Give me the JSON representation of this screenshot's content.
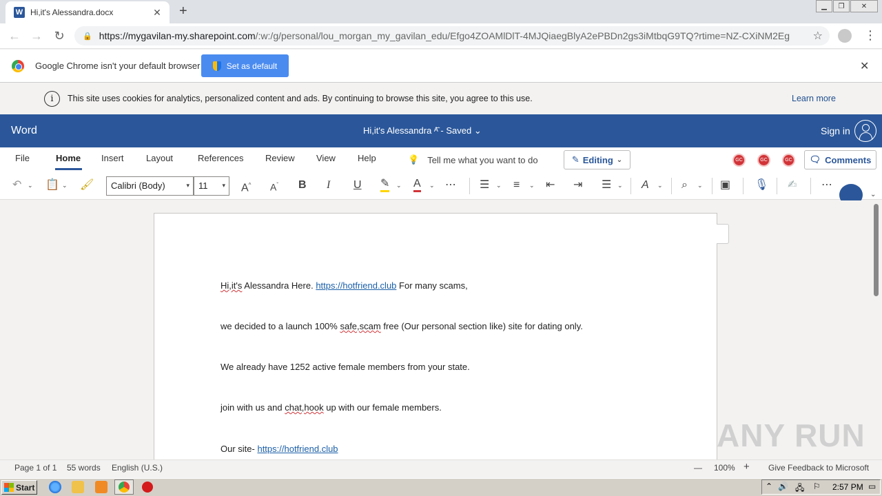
{
  "browser": {
    "tab_title": "Hi,it's Alessandra.docx",
    "tab_close": "✕",
    "new_tab": "+",
    "url_domain": "https://mygavilan-my.sharepoint.com",
    "url_path": "/:w:/g/personal/lou_morgan_my_gavilan_edu/Efgo4ZOAMlDlT-4MJQiaegBlyA2ePBDn2gs3iMtbqG9TQ?rtime=NZ-CXiNM2Eg",
    "infobar_text": "Google Chrome isn't your default browser",
    "set_default_label": "Set as default"
  },
  "cookie_banner": {
    "text": "This site uses cookies for analytics, personalized content and ads. By continuing to browse this site, you agree to this use.",
    "learn_more": "Learn more",
    "info_glyph": "i"
  },
  "word": {
    "brand": "Word",
    "doc_title": "Hi,it's Alessandra  ᴬ᷈ -  Saved ⌄",
    "sign_in": "Sign in",
    "tabs": [
      "File",
      "Home",
      "Insert",
      "Layout",
      "References",
      "Review",
      "View",
      "Help"
    ],
    "tell_me": "Tell me what you want to do",
    "editing_label": "Editing",
    "coauthors": [
      "GC",
      "GC",
      "GC"
    ],
    "comments_label": "Comments",
    "font_name": "Calibri (Body)",
    "font_size": "11"
  },
  "document": {
    "line1_pre": "Hi,it's",
    "line1_mid": " Alessandra Here. ",
    "line1_link": "https://hotfriend.club",
    "line1_post": " For many scams,",
    "line2_pre": "we decided to a launch 100% ",
    "line2_squig": "safe,scam",
    "line2_post": " free (Our personal section like) site for dating only.",
    "line3": "We already have 1252 active female members from your state.",
    "line4_pre": "join with us and ",
    "line4_squig": "chat,hook",
    "line4_post": " up with our female members.",
    "line5_pre": "Our site- ",
    "line5_link": "https://hotfriend.club"
  },
  "status": {
    "page": "Page 1 of 1",
    "words": "55 words",
    "language": "English (U.S.)",
    "zoom_minus": "—",
    "zoom": "100%",
    "zoom_plus": "+",
    "feedback": "Give Feedback to Microsoft"
  },
  "watermark": "ANY RUN",
  "taskbar": {
    "start": "Start",
    "clock": "2:57 PM"
  },
  "colors": {
    "word_blue": "#2b579a",
    "chrome_button": "#4a8bf0",
    "link": "#1b5fa8",
    "coauthor_red": "#d13438"
  }
}
